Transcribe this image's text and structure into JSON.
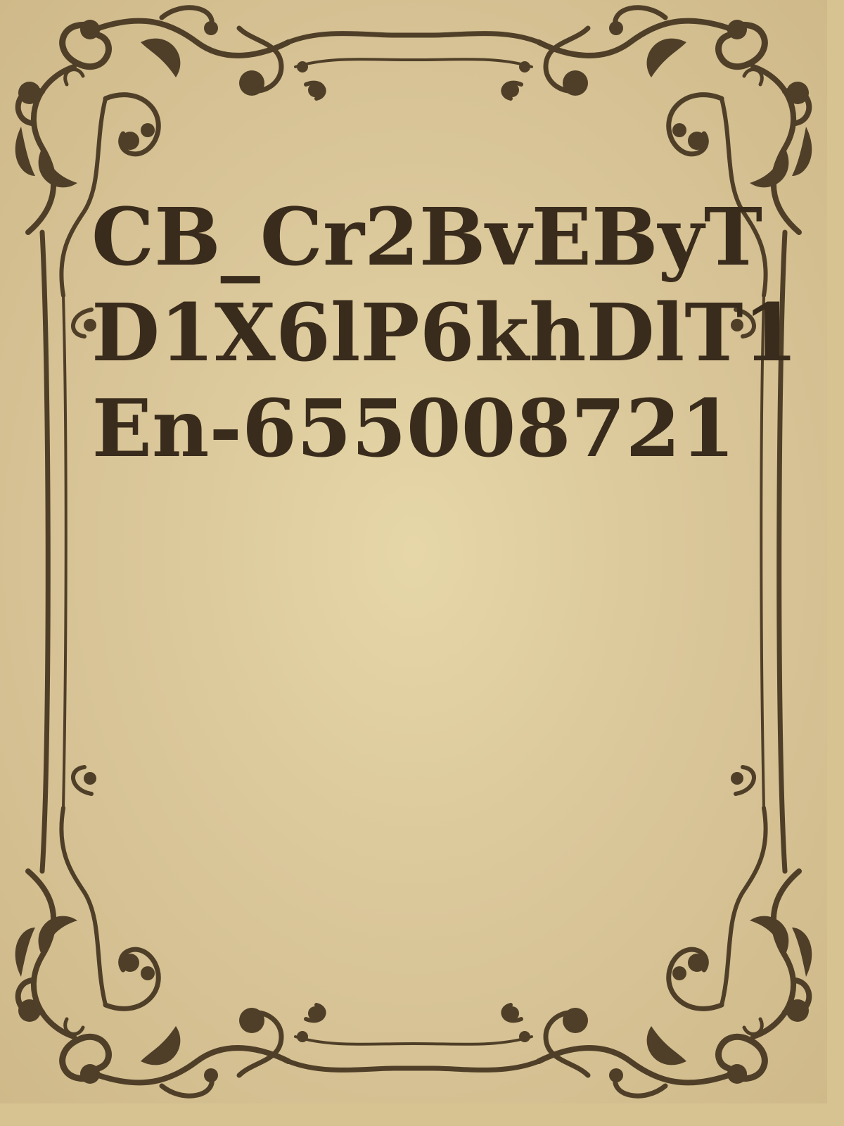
{
  "cover": {
    "title_lines": [
      "CB_Cr2BvEByT",
      "D1X6lP6khDlT1",
      "En-655008721"
    ]
  },
  "colors": {
    "background": "#dccb9c",
    "ornament": "#4f3f28",
    "title_text": "#3a2c1c"
  },
  "ornament": {
    "icon": "flourish-frame-icon"
  }
}
